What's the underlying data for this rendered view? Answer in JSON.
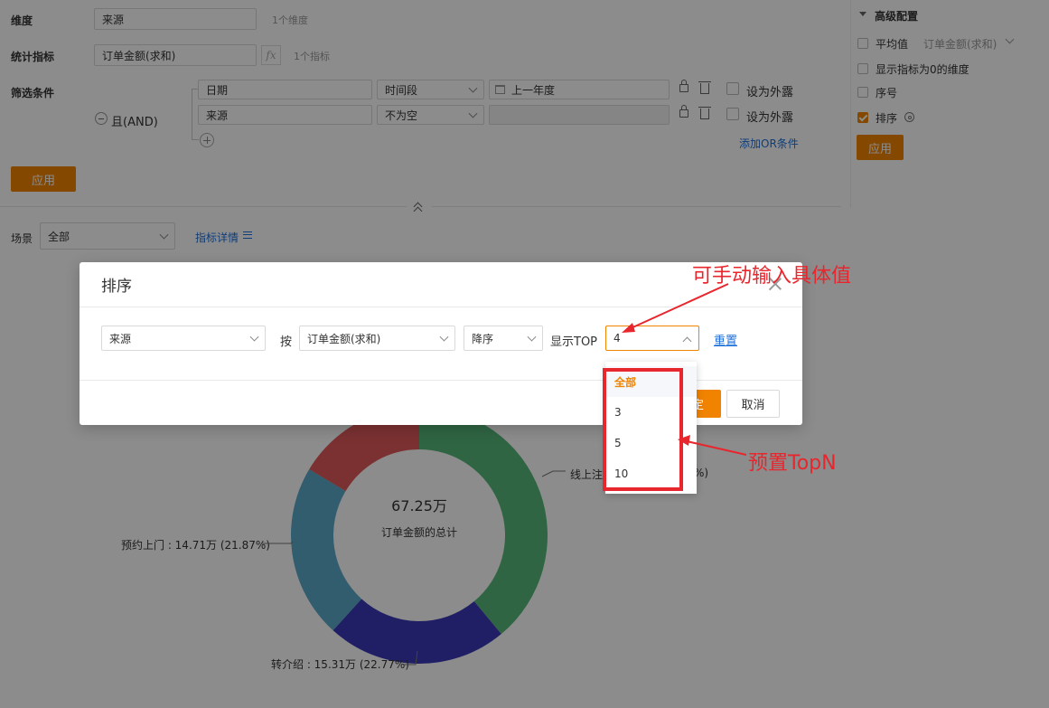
{
  "config": {
    "dimension_label": "维度",
    "dimension_value": "来源",
    "dimension_count": "1个维度",
    "metric_label": "统计指标",
    "metric_value": "订单金额(求和)",
    "metric_fx": "fx",
    "metric_count": "1个指标",
    "filter_label": "筛选条件",
    "and_label": "且(AND)",
    "filters": [
      {
        "field": "日期",
        "op": "时间段",
        "value": "上一年度",
        "expose": "设为外露"
      },
      {
        "field": "来源",
        "op": "不为空",
        "value": "",
        "expose": "设为外露"
      }
    ],
    "add_or": "添加OR条件",
    "apply": "应用"
  },
  "scene": {
    "label": "场景",
    "value": "全部",
    "metric_detail": "指标详情"
  },
  "advanced": {
    "title": "高级配置",
    "average_label": "平均值",
    "average_select": "订单金额(求和)",
    "show_zero": "显示指标为0的维度",
    "serial": "序号",
    "sort": "排序",
    "apply": "应用"
  },
  "chart_data": {
    "type": "pie",
    "center_value": "67.25万",
    "center_label": "订单金额的总计",
    "slices": [
      {
        "label": "线上注册",
        "display": "线上注",
        "value": 0.3896,
        "color": "#57b87a"
      },
      {
        "label": "转介绍",
        "display": "转介绍 : 15.31万 (22.77%)",
        "value": 0.2277,
        "color": "#3b3ab8"
      },
      {
        "label": "预约上门",
        "display": "预约上门 : 14.71万 (21.87%)",
        "value": 0.2187,
        "color": "#5aa9c9"
      },
      {
        "label": "",
        "display": "",
        "value": 0.164,
        "color": "#e0595b"
      }
    ],
    "partial_label_right": "%)"
  },
  "modal": {
    "title": "排序",
    "field": "来源",
    "by_label": "按",
    "metric": "订单金额(求和)",
    "order": "降序",
    "top_label": "显示TOP",
    "top_value": "4",
    "reset": "重置",
    "confirm": "定",
    "cancel": "取消"
  },
  "dropdown": {
    "options": [
      "全部",
      "3",
      "5",
      "10"
    ],
    "selected": "全部"
  },
  "annotations": {
    "manual": "可手动输入具体值",
    "preset": "预置TopN"
  },
  "colors": {
    "accent": "#f08300",
    "link": "#1e6fd9",
    "annotation": "#e8262d"
  }
}
